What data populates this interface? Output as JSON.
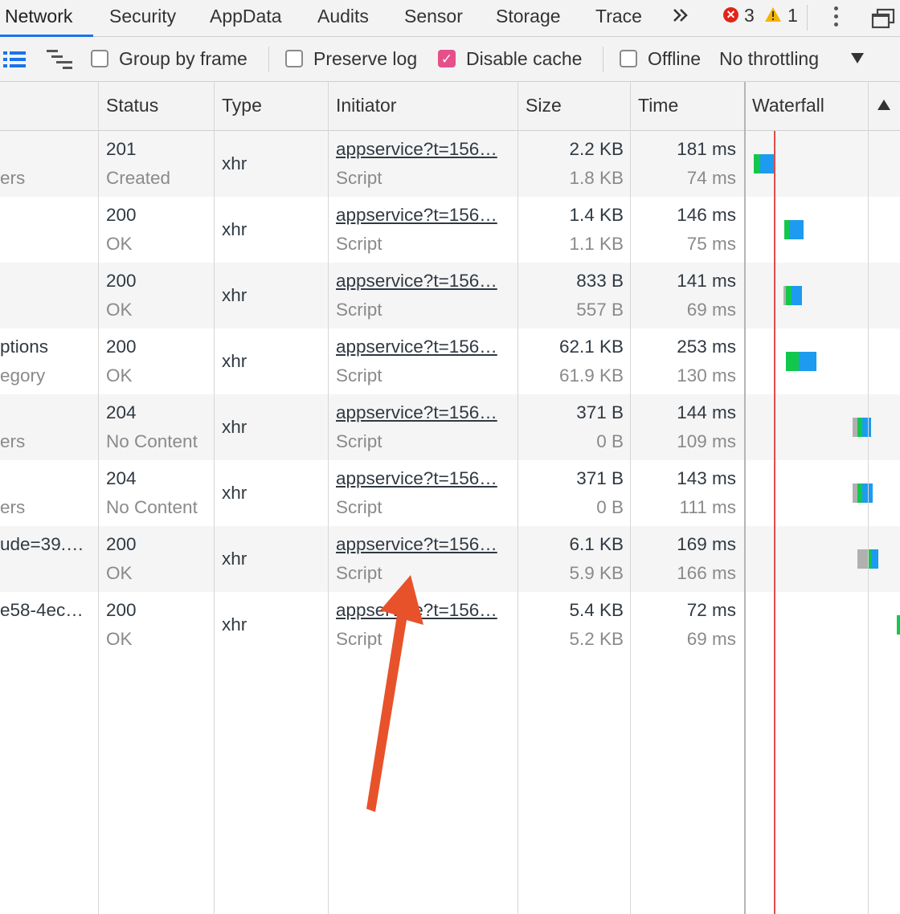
{
  "tabs": [
    {
      "label": "Network",
      "active": true
    },
    {
      "label": "Security"
    },
    {
      "label": "AppData"
    },
    {
      "label": "Audits"
    },
    {
      "label": "Sensor"
    },
    {
      "label": "Storage"
    },
    {
      "label": "Trace"
    }
  ],
  "tabbar": {
    "more_icon": "double-chevron-right-icon",
    "error_count": "3",
    "warning_count": "1",
    "error_color": "#e2231a",
    "warning_color": "#f4b400"
  },
  "toolbar": {
    "group_by_frame": {
      "label": "Group by frame",
      "checked": false
    },
    "preserve_log": {
      "label": "Preserve log",
      "checked": false
    },
    "disable_cache": {
      "label": "Disable cache",
      "checked": true
    },
    "offline": {
      "label": "Offline",
      "checked": false
    },
    "throttling": "No throttling",
    "checked_color": "#e6508a"
  },
  "columns": {
    "status": "Status",
    "type": "Type",
    "initiator": "Initiator",
    "size": "Size",
    "time": "Time",
    "waterfall": "Waterfall"
  },
  "rows": [
    {
      "name": "",
      "name_sub": "ers",
      "status": "201",
      "status_text": "Created",
      "type": "xhr",
      "initiator": "appservice?t=156…",
      "initiator_sub": "Script",
      "size": "2.2 KB",
      "size_sub": "1.8 KB",
      "time": "181 ms",
      "time_sub": "74 ms"
    },
    {
      "name": "",
      "name_sub": "",
      "status": "200",
      "status_text": "OK",
      "type": "xhr",
      "initiator": "appservice?t=156…",
      "initiator_sub": "Script",
      "size": "1.4 KB",
      "size_sub": "1.1 KB",
      "time": "146 ms",
      "time_sub": "75 ms"
    },
    {
      "name": "",
      "name_sub": "",
      "status": "200",
      "status_text": "OK",
      "type": "xhr",
      "initiator": "appservice?t=156…",
      "initiator_sub": "Script",
      "size": "833 B",
      "size_sub": "557 B",
      "time": "141 ms",
      "time_sub": "69 ms"
    },
    {
      "name": "ptions",
      "name_sub": "egory",
      "status": "200",
      "status_text": "OK",
      "type": "xhr",
      "initiator": "appservice?t=156…",
      "initiator_sub": "Script",
      "size": "62.1 KB",
      "size_sub": "61.9 KB",
      "time": "253 ms",
      "time_sub": "130 ms"
    },
    {
      "name": "",
      "name_sub": "ers",
      "status": "204",
      "status_text": "No Content",
      "type": "xhr",
      "initiator": "appservice?t=156…",
      "initiator_sub": "Script",
      "size": "371 B",
      "size_sub": "0 B",
      "time": "144 ms",
      "time_sub": "109 ms"
    },
    {
      "name": "",
      "name_sub": "ers",
      "status": "204",
      "status_text": "No Content",
      "type": "xhr",
      "initiator": "appservice?t=156…",
      "initiator_sub": "Script",
      "size": "371 B",
      "size_sub": "0 B",
      "time": "143 ms",
      "time_sub": "111 ms"
    },
    {
      "name": "ude=39.…",
      "name_sub": "",
      "status": "200",
      "status_text": "OK",
      "type": "xhr",
      "initiator": "appservice?t=156…",
      "initiator_sub": "Script",
      "size": "6.1 KB",
      "size_sub": "5.9 KB",
      "time": "169 ms",
      "time_sub": "166 ms"
    },
    {
      "name": "e58-4ec…",
      "name_sub": "",
      "status": "200",
      "status_text": "OK",
      "type": "xhr",
      "initiator": "appservice?t=156…",
      "initiator_sub": "Script",
      "size": "5.4 KB",
      "size_sub": "5.2 KB",
      "time": "72 ms",
      "time_sub": "69 ms"
    }
  ],
  "waterfall_colors": {
    "queue": "#b0b0b0",
    "waiting": "#12c84c",
    "download": "#1d9bf0"
  },
  "annotation": {
    "type": "arrow",
    "color": "#e8522b"
  }
}
